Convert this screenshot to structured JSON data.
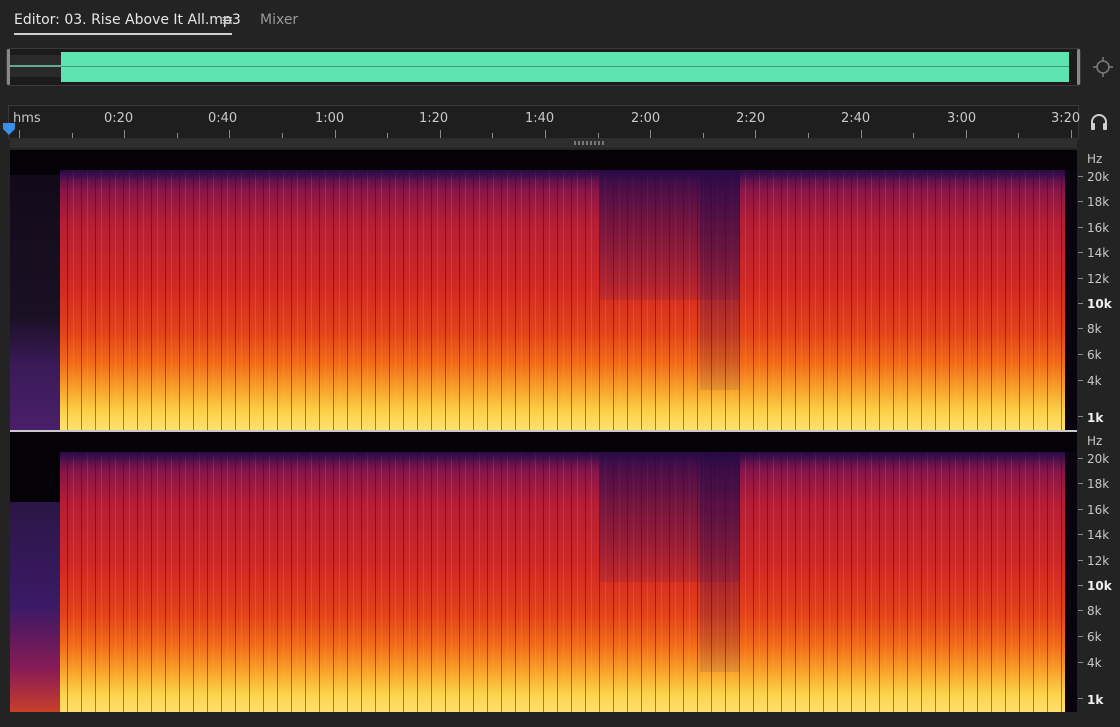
{
  "tabs": {
    "editor_label": "Editor: 03. Rise Above It All.mp3",
    "menu_glyph": "≡",
    "mixer_label": "Mixer"
  },
  "ruler": {
    "unit": "hms",
    "labels": [
      "0:20",
      "0:40",
      "1:00",
      "1:20",
      "1:40",
      "2:00",
      "2:20",
      "2:40",
      "3:00",
      "3:20"
    ]
  },
  "frequency_scale": {
    "unit": "Hz",
    "labels": [
      "20k",
      "18k",
      "16k",
      "14k",
      "12k",
      "10k",
      "8k",
      "6k",
      "4k",
      "1k"
    ]
  },
  "colors": {
    "waveform": "#5ee4b0",
    "playhead": "#3a8fe8",
    "spectrogram_low": "#ffe070",
    "spectrogram_high": "#3a0f4a"
  },
  "icons": {
    "menu": "hamburger-icon",
    "zoom": "zoom-navigator-icon",
    "monitor": "headphones-icon",
    "playhead": "playhead-marker-icon"
  }
}
